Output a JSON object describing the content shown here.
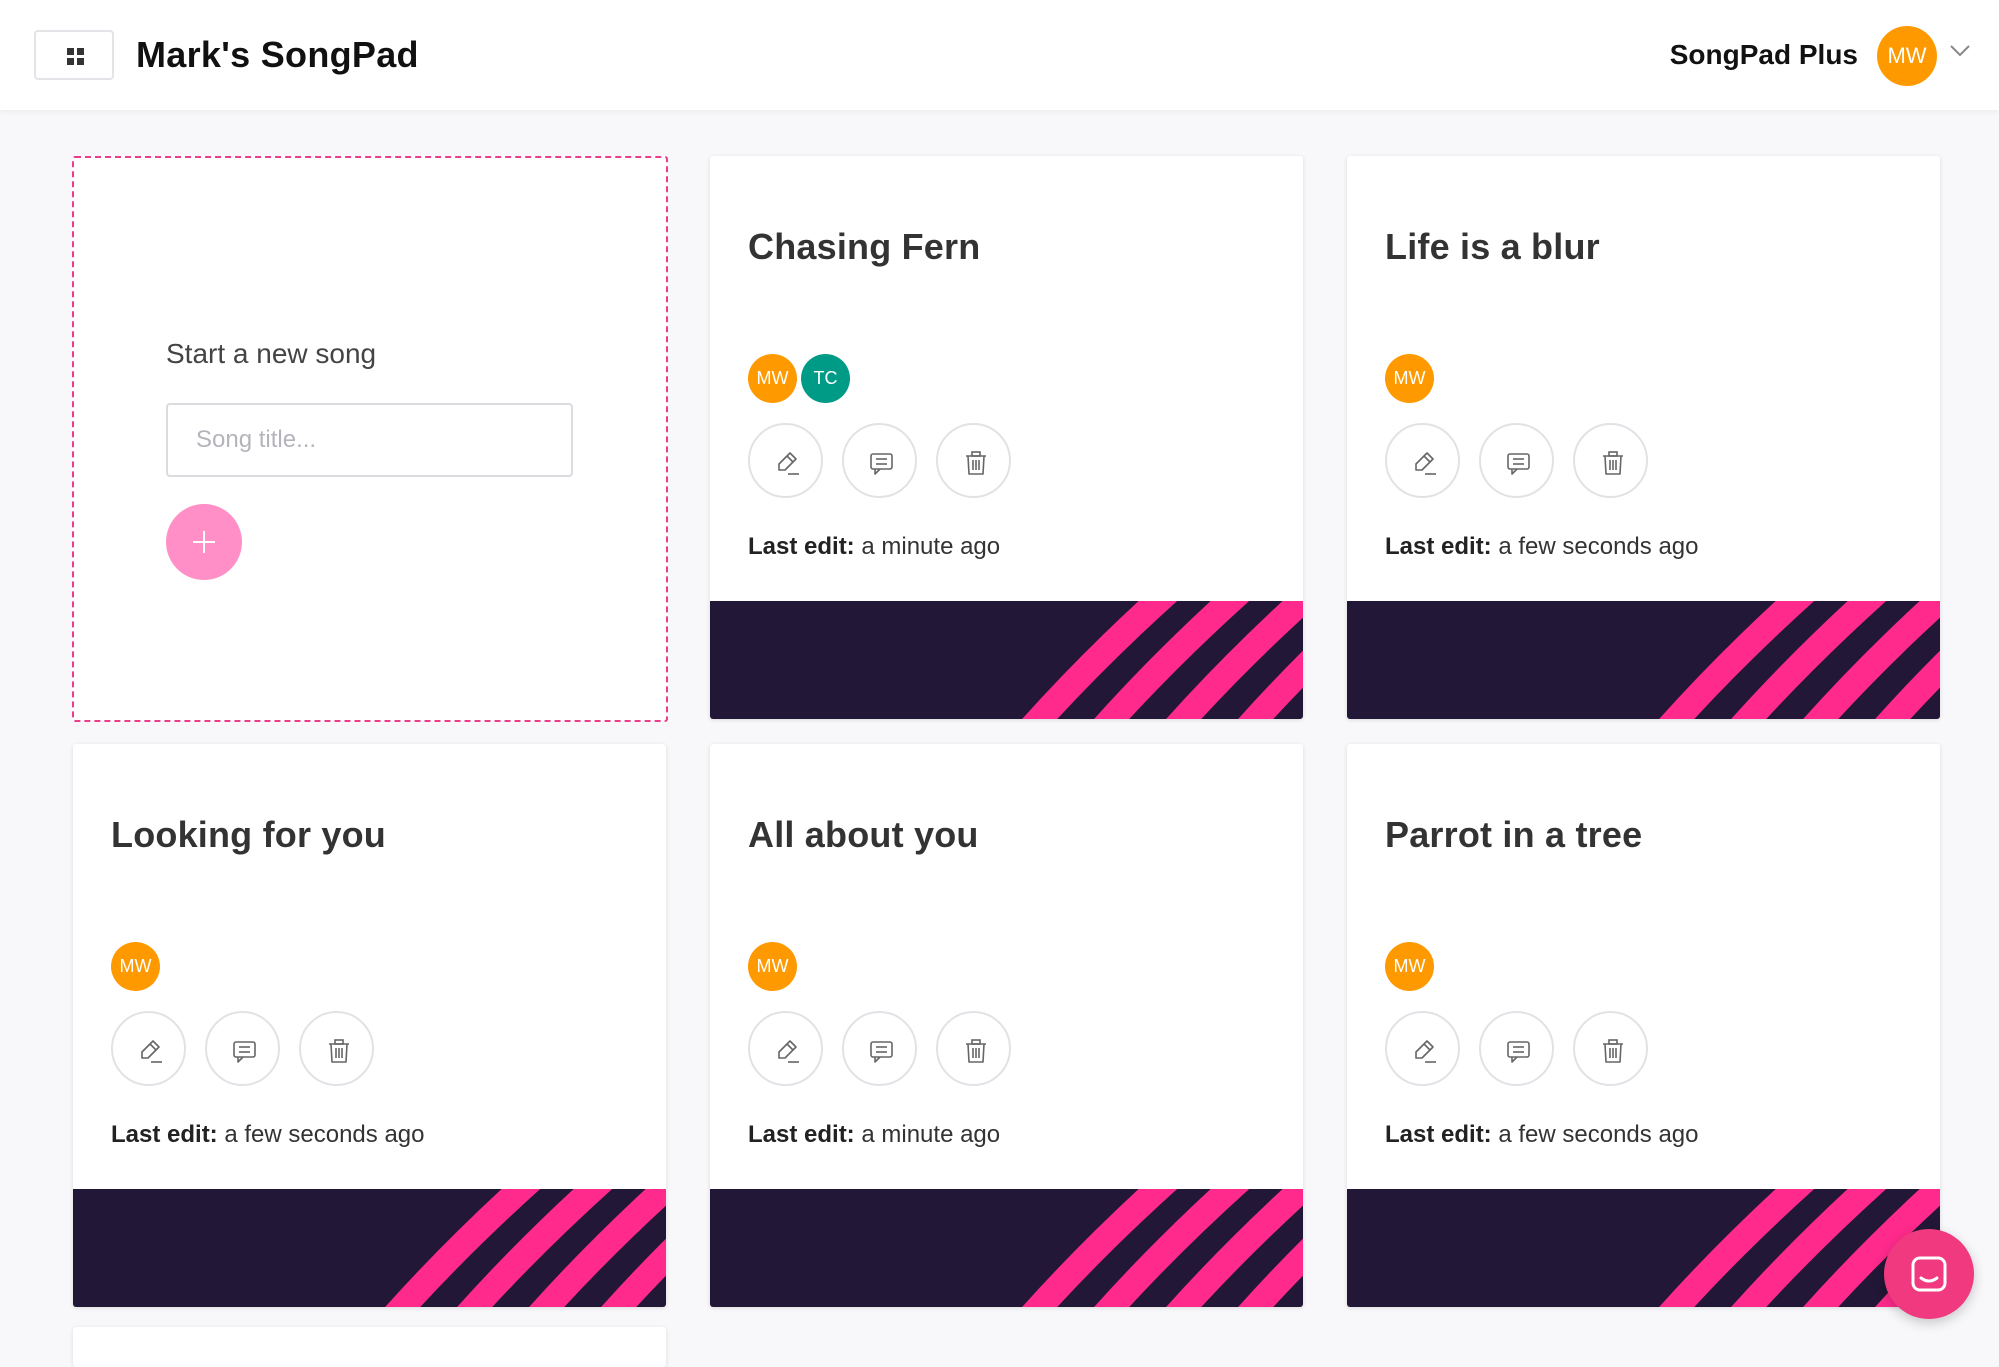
{
  "header": {
    "title": "Mark's SongPad",
    "menu_icon": "grid-icon",
    "plan_label": "SongPad Plus",
    "user_initials": "MW",
    "user_color": "#ff9900"
  },
  "new_song": {
    "label": "Start a new song",
    "placeholder": "Song title...",
    "value": "",
    "add_icon": "plus-icon"
  },
  "colors": {
    "accent": "#ff2a8c",
    "banner_dark": "#221737",
    "avatar_mw": "#ff9900",
    "avatar_tc": "#009b87"
  },
  "cards": [
    {
      "title": "Chasing Fern",
      "collaborators": [
        {
          "initials": "MW",
          "color": "#ff9900"
        },
        {
          "initials": "TC",
          "color": "#009b87"
        }
      ],
      "last_edit_label": "Last edit:",
      "last_edit_value": "a minute ago"
    },
    {
      "title": "Life is a blur",
      "collaborators": [
        {
          "initials": "MW",
          "color": "#ff9900"
        }
      ],
      "last_edit_label": "Last edit:",
      "last_edit_value": "a few seconds ago"
    },
    {
      "title": "Looking for you",
      "collaborators": [
        {
          "initials": "MW",
          "color": "#ff9900"
        }
      ],
      "last_edit_label": "Last edit:",
      "last_edit_value": "a few seconds ago"
    },
    {
      "title": "All about you",
      "collaborators": [
        {
          "initials": "MW",
          "color": "#ff9900"
        }
      ],
      "last_edit_label": "Last edit:",
      "last_edit_value": "a minute ago"
    },
    {
      "title": "Parrot in a tree",
      "collaborators": [
        {
          "initials": "MW",
          "color": "#ff9900"
        }
      ],
      "last_edit_label": "Last edit:",
      "last_edit_value": "a few seconds ago"
    }
  ],
  "card_actions": [
    {
      "icon": "pencil-icon",
      "name": "edit"
    },
    {
      "icon": "comment-icon",
      "name": "comments"
    },
    {
      "icon": "trash-icon",
      "name": "delete"
    }
  ],
  "chat": {
    "icon": "chat-icon"
  }
}
